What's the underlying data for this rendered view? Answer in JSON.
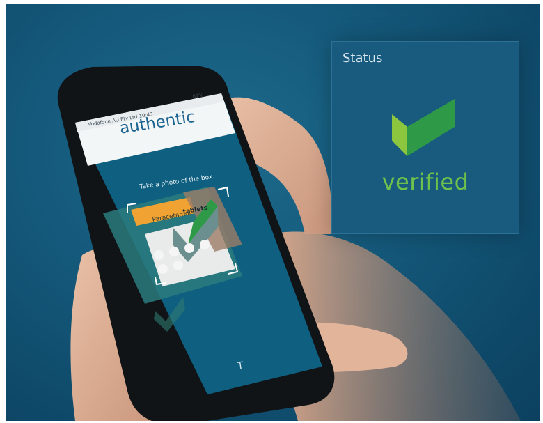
{
  "status_card": {
    "label": "Status",
    "state": "verified",
    "icon": "checkmark-icon",
    "text_color": "#6ec14b"
  },
  "phone": {
    "brand": "authentic",
    "carrier": "Vodafone AU Pty Ltd",
    "time": "10:43",
    "battery": "81%",
    "instruction": "Take a photo of the box.",
    "pack_label": "tablets",
    "pack_label_2": "Paracetamol",
    "button_partial": "T"
  },
  "colors": {
    "background": "#155a7c",
    "card": "#195b7e",
    "check_light": "#8cc63f",
    "check_dark": "#2e9a48"
  }
}
